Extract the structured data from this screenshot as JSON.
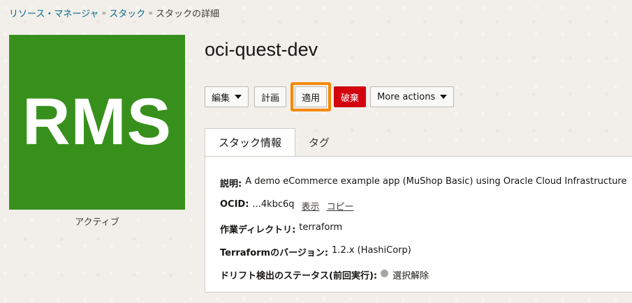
{
  "breadcrumb": {
    "items": [
      "リソース・マネージャ",
      "スタック"
    ],
    "separator": "»",
    "current": "スタックの詳細"
  },
  "logo": {
    "text": "RMS",
    "color": "#38901c"
  },
  "status": "アクティブ",
  "title": "oci-quest-dev",
  "actions": {
    "edit": "編集",
    "plan": "計画",
    "apply": "適用",
    "destroy": "破棄",
    "more": "More actions",
    "highlight_color": "#f58a09",
    "destroy_color": "#d5000e"
  },
  "tabs": [
    {
      "label": "スタック情報",
      "active": true
    },
    {
      "label": "タグ",
      "active": false
    }
  ],
  "details": {
    "description_label": "説明:",
    "description_value": "A demo eCommerce example app (MuShop Basic) using Oracle Cloud Infrastructure",
    "ocid_label": "OCID:",
    "ocid_value": "...4kbc6q",
    "ocid_show": "表示",
    "ocid_copy": "コピー",
    "workdir_label": "作業ディレクトリ:",
    "workdir_value": "terraform",
    "tf_version_label": "Terraformのバージョン:",
    "tf_version_value": "1.2.x (HashiCorp)",
    "drift_label": "ドリフト検出のステータス(前回実行):",
    "drift_value": "選択解除"
  }
}
